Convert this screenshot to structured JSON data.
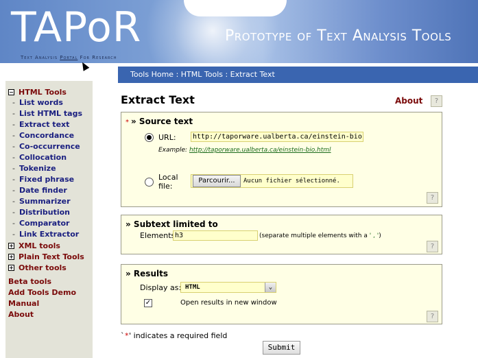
{
  "header": {
    "logo": "TAPoR",
    "logo_sub_pre": "Text Analysis ",
    "logo_sub_portal": "Portal",
    "logo_sub_post": " For Research",
    "site_title": "Prototype of Text Analysis Tools"
  },
  "breadcrumb": "Tools Home : HTML Tools : Extract Text",
  "sidebar": {
    "html_tools": {
      "label": "HTML Tools",
      "toggle": "−",
      "items": [
        "List words",
        "List HTML tags",
        "Extract text",
        "Concordance",
        "Co-occurrence",
        "Collocation",
        "Tokenize",
        "Fixed phrase",
        "Date finder",
        "Summarizer",
        "Distribution",
        "Comparator",
        "Link Extractor"
      ]
    },
    "xml_tools": {
      "label": "XML tools",
      "toggle": "+"
    },
    "plain_text_tools": {
      "label": "Plain Text Tools",
      "toggle": "+"
    },
    "other_tools": {
      "label": "Other tools",
      "toggle": "+"
    },
    "links": [
      "Beta tools",
      "Add Tools Demo",
      "Manual",
      "About"
    ]
  },
  "page": {
    "title": "Extract Text",
    "about_link": "About",
    "help": "?"
  },
  "source": {
    "required_mark": "*",
    "title": "» Source text",
    "url_label": "URL:",
    "url_value": "http://taporware.ualberta.ca/einstein-bio",
    "example_label": "Example: ",
    "example_link": "http://taporware.ualberta.ca/einstein-bio.html",
    "local_label_1": "Local",
    "local_label_2": "file:",
    "browse_button": "Parcourir...",
    "no_file": "Aucun fichier sélectionné."
  },
  "subtext": {
    "title": "» Subtext limited to",
    "elements_label": "Elements:",
    "elements_value": "h3",
    "hint_pre": "(separate multiple elements with a ",
    "hint_sep": "' , '",
    "hint_post": ")"
  },
  "results": {
    "title": "» Results",
    "display_label": "Display as:",
    "display_value": "HTML",
    "open_new_window_label": "Open results in new window",
    "open_new_window_checked": true
  },
  "footer": {
    "req_note_pre": "`",
    "req_note_star": "*",
    "req_note_post": "' indicates a required field",
    "submit_label": "Submit"
  }
}
